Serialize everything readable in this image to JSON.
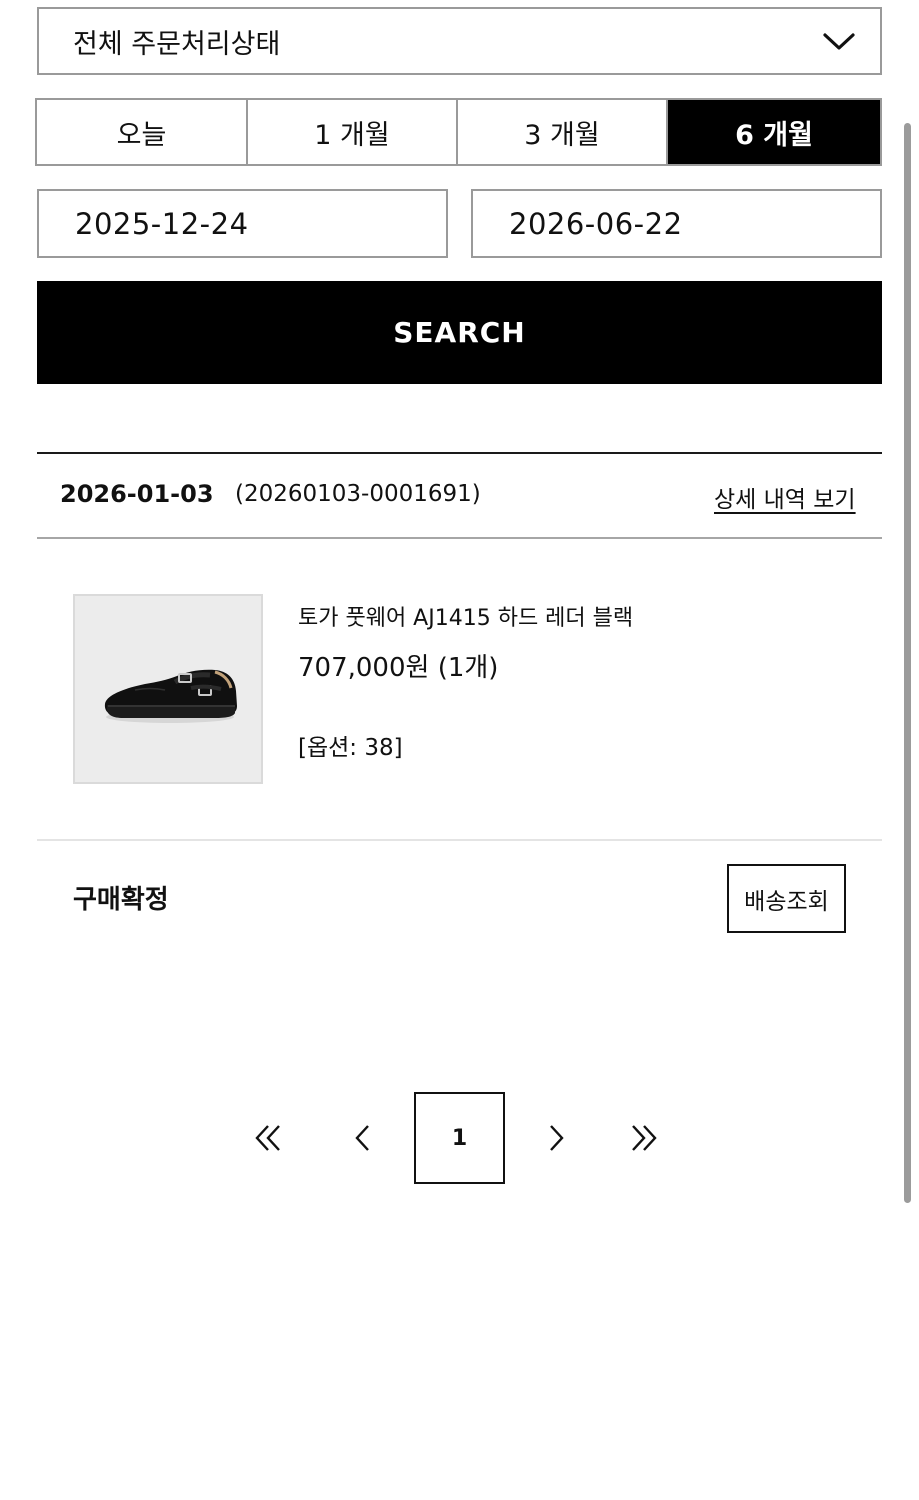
{
  "status_filter": {
    "selected": "전체 주문처리상태"
  },
  "period_tabs": [
    {
      "label": "오늘"
    },
    {
      "label": "1 개월"
    },
    {
      "label": "3 개월"
    },
    {
      "label": "6 개월",
      "active": true
    }
  ],
  "date_range": {
    "start": "2025-12-24",
    "end": "2026-06-22"
  },
  "search_label": "SEARCH",
  "order": {
    "date": "2026-01-03",
    "number": "(20260103-0001691)",
    "detail_link": "상세 내역 보기",
    "item": {
      "name": "토가 풋웨어 AJ1415 하드 레더 블랙",
      "price": "707,000원 (1개)",
      "option": "[옵션: 38]",
      "image_icon": "shoe-image"
    },
    "status": "구매확정",
    "track_button": "배송조회"
  },
  "pagination": {
    "current_page": "1",
    "icons": [
      "double-chevron-left-icon",
      "chevron-left-icon",
      "chevron-right-icon",
      "double-chevron-right-icon"
    ]
  },
  "colors": {
    "accent": "#000000",
    "border": "#9a9a9a",
    "thumb_bg": "#ececec"
  }
}
